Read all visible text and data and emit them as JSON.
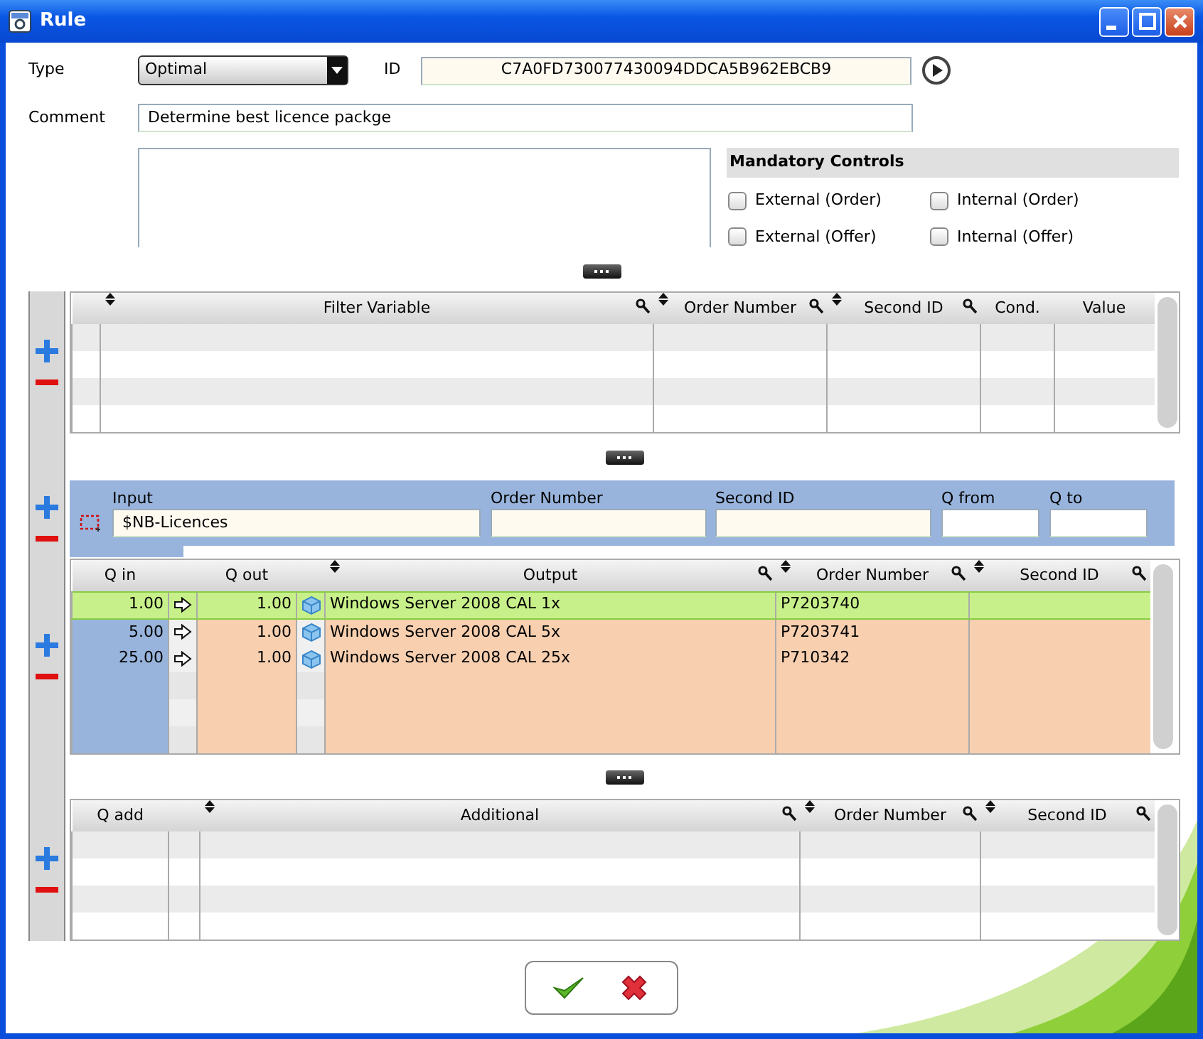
{
  "window": {
    "title": "Rule"
  },
  "form": {
    "type": {
      "label": "Type",
      "value": "Optimal"
    },
    "id": {
      "label": "ID",
      "value": "C7A0FD730077430094DDCA5B962EBCB9"
    },
    "comment": {
      "label": "Comment",
      "value": "Determine best licence packge"
    }
  },
  "mandatory_controls": {
    "title": "Mandatory Controls",
    "items": [
      {
        "label": "External (Order)",
        "checked": false
      },
      {
        "label": "Internal (Order)",
        "checked": false
      },
      {
        "label": "External (Offer)",
        "checked": false
      },
      {
        "label": "Internal (Offer)",
        "checked": false
      }
    ]
  },
  "filter_table": {
    "columns": [
      {
        "label": "Filter Variable",
        "sort_marker": true,
        "key_marker": true
      },
      {
        "label": "Order Number",
        "sort_marker": true,
        "key_marker": true
      },
      {
        "label": "Second ID",
        "sort_marker": true,
        "key_marker": true
      },
      {
        "label": "Cond.",
        "sort_marker": false,
        "key_marker": false
      },
      {
        "label": "Value",
        "sort_marker": false,
        "key_marker": false
      }
    ]
  },
  "input_panel": {
    "fields": [
      {
        "label": "Input",
        "value": "$NB-Licences"
      },
      {
        "label": "Order Number"
      },
      {
        "label": "Second ID"
      },
      {
        "label": "Q from"
      },
      {
        "label": "Q to"
      }
    ]
  },
  "output_table": {
    "columns": [
      {
        "label": "Q in",
        "sort_marker": false,
        "key_marker": false
      },
      {
        "label": "Q out",
        "sort_marker": false,
        "key_marker": false
      },
      {
        "label": "Output",
        "sort_marker": true,
        "key_marker": true
      },
      {
        "label": "Order Number",
        "sort_marker": true,
        "key_marker": true
      },
      {
        "label": "Second ID",
        "sort_marker": true,
        "key_marker": true
      }
    ],
    "rows": [
      {
        "q_in": "1.00",
        "q_out": "1.00",
        "output": "Windows Server 2008 CAL 1x",
        "order_number": "P7203740",
        "selected": true
      },
      {
        "q_in": "5.00",
        "q_out": "1.00",
        "output": "Windows Server 2008 CAL 5x",
        "order_number": "P7203741",
        "selected": false
      },
      {
        "q_in": "25.00",
        "q_out": "1.00",
        "output": "Windows Server 2008 CAL 25x",
        "order_number": "P710342",
        "selected": false
      }
    ]
  },
  "additional_table": {
    "columns": [
      {
        "label": "Q add",
        "sort_marker": false,
        "key_marker": false
      },
      {
        "label": "Additional",
        "sort_marker": true,
        "key_marker": true
      },
      {
        "label": "Order Number",
        "sort_marker": true,
        "key_marker": true
      },
      {
        "label": "Second ID",
        "sort_marker": true,
        "key_marker": true
      }
    ]
  }
}
